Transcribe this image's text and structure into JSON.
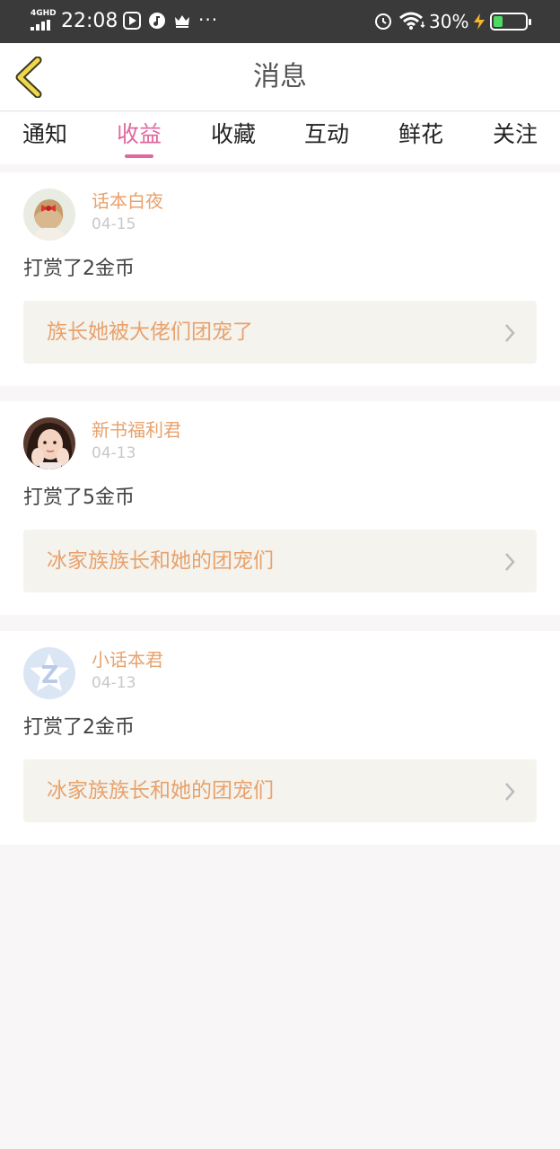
{
  "status_bar": {
    "network": "4GHD",
    "time": "22:08",
    "icons": [
      "play-icon",
      "music-icon",
      "crown-icon"
    ],
    "more": "···",
    "battery_percent": "30%",
    "battery_level": 0.3
  },
  "header": {
    "title": "消息",
    "back_icon": "chevron-left-icon"
  },
  "tabs": [
    {
      "label": "通知",
      "active": false
    },
    {
      "label": "收益",
      "active": true
    },
    {
      "label": "收藏",
      "active": false
    },
    {
      "label": "互动",
      "active": false
    },
    {
      "label": "鲜花",
      "active": false
    },
    {
      "label": "关注",
      "active": false
    }
  ],
  "messages": [
    {
      "user": "话本白夜",
      "date": "04-15",
      "reward": "打赏了2金币",
      "book": "族长她被大佬们团宠了",
      "avatar": "girl-bow"
    },
    {
      "user": "新书福利君",
      "date": "04-13",
      "reward": "打赏了5金币",
      "book": "冰家族族长和她的团宠们",
      "avatar": "girl-hands"
    },
    {
      "user": "小话本君",
      "date": "04-13",
      "reward": "打赏了2金币",
      "book": "冰家族族长和她的团宠们",
      "avatar": "default-z"
    }
  ],
  "colors": {
    "accent": "#e0689f",
    "name": "#e8a26c",
    "status_bar": "#3a3a3a"
  }
}
